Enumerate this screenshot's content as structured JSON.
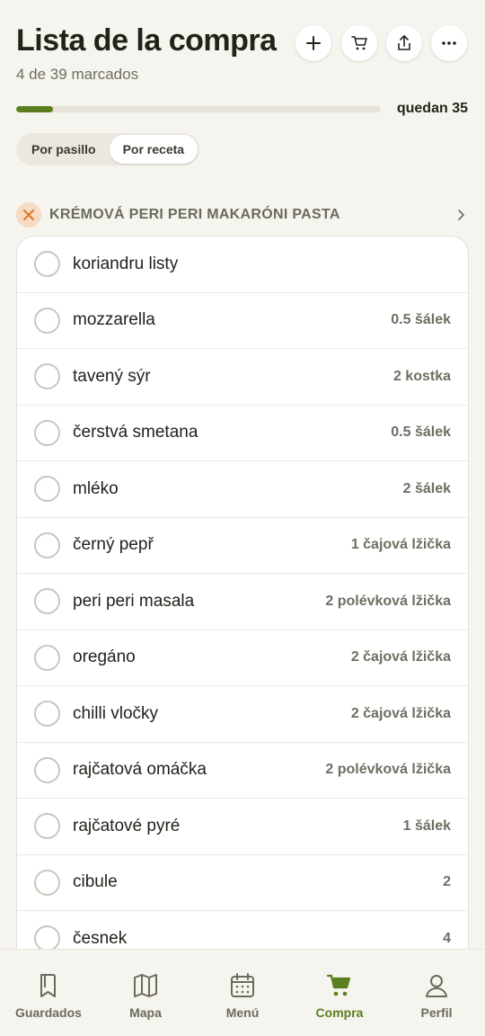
{
  "header": {
    "title": "Lista de la compra",
    "subtitle": "4 de 39 marcados",
    "progress_fraction": 0.1,
    "remaining": "quedan 35"
  },
  "actions": [
    {
      "icon": "plus-icon"
    },
    {
      "icon": "cart-icon"
    },
    {
      "icon": "share-icon"
    },
    {
      "icon": "more-icon"
    }
  ],
  "view_toggle": {
    "options": [
      "Por pasillo",
      "Por receta"
    ],
    "selected": "Por receta"
  },
  "recipe": {
    "title": "KRÉMOVÁ PERI PERI MAKARÓNI PASTA",
    "icon": "utensils-icon",
    "items": [
      {
        "name": "koriandru listy",
        "qty": ""
      },
      {
        "name": "mozzarella",
        "qty": "0.5 šálek"
      },
      {
        "name": "tavený sýr",
        "qty": "2 kostka"
      },
      {
        "name": "čerstvá smetana",
        "qty": "0.5 šálek"
      },
      {
        "name": "mléko",
        "qty": "2 šálek"
      },
      {
        "name": "černý pepř",
        "qty": "1 čajová lžička"
      },
      {
        "name": "peri peri masala",
        "qty": "2 polévková lžička"
      },
      {
        "name": "oregáno",
        "qty": "2 čajová lžička"
      },
      {
        "name": "chilli vločky",
        "qty": "2 čajová lžička"
      },
      {
        "name": "rajčatová omáčka",
        "qty": "2 polévková lžička"
      },
      {
        "name": "rajčatové pyré",
        "qty": "1 šálek"
      },
      {
        "name": "cibule",
        "qty": "2"
      },
      {
        "name": "česnek",
        "qty": "4"
      }
    ]
  },
  "tabbar": {
    "tabs": [
      {
        "label": "Guardados",
        "icon": "bookmark-icon"
      },
      {
        "label": "Mapa",
        "icon": "map-icon"
      },
      {
        "label": "Menú",
        "icon": "calendar-icon"
      },
      {
        "label": "Compra",
        "icon": "cart-icon"
      },
      {
        "label": "Perfil",
        "icon": "user-icon"
      }
    ],
    "active": "Compra"
  },
  "colors": {
    "accent": "#5b7f1e",
    "background": "#f6f4ee",
    "muted_text": "#6e6e62"
  }
}
